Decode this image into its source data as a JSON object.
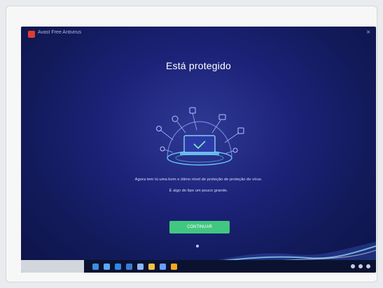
{
  "window": {
    "app_title": "Avast Free Antivirus",
    "close_glyph": "×"
  },
  "main": {
    "status_title": "Está protegido",
    "message": "Agora tem tú uma bom e ótimo nível de proteção de proteção de vírus.",
    "submessage": "É algo do tipo um pouco grande.",
    "button_label": "CONTINUAR",
    "illustration_icon": "laptop-shield-icon"
  },
  "taskbar": {
    "search_placeholder": "",
    "icons": [
      "start-icon",
      "task-view-icon",
      "edge-icon",
      "store-icon",
      "mail-icon",
      "explorer-icon",
      "photos-icon",
      "avast-icon"
    ],
    "icon_colors": [
      "#3f8ddf",
      "#5aa7ff",
      "#2f86e9",
      "#3b7bd6",
      "#8bb5ff",
      "#f2c04a",
      "#6e9bff",
      "#f5a623"
    ]
  },
  "colors": {
    "accent_green": "#42c781",
    "brand_red": "#e23b32",
    "background_blue": "#1c2278"
  }
}
